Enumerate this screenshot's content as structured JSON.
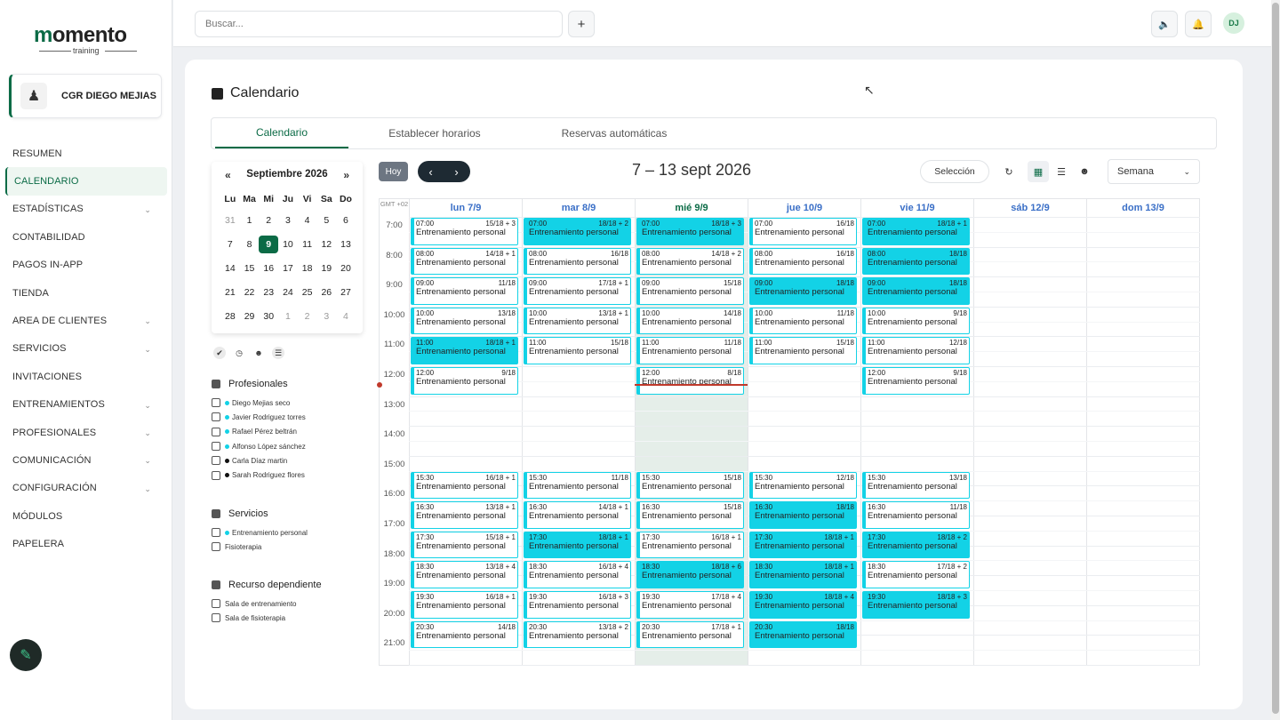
{
  "brand": {
    "name": "momento",
    "sub": "training"
  },
  "business": {
    "name": "CGR DIEGO MEJIAS"
  },
  "nav": [
    {
      "label": "RESUMEN",
      "caret": false
    },
    {
      "label": "CALENDARIO",
      "caret": false,
      "active": true
    },
    {
      "label": "ESTADÍSTICAS",
      "caret": true
    },
    {
      "label": "CONTABILIDAD",
      "caret": false
    },
    {
      "label": "PAGOS IN-APP",
      "caret": false
    },
    {
      "label": "TIENDA",
      "caret": false
    },
    {
      "label": "AREA DE CLIENTES",
      "caret": true
    },
    {
      "label": "SERVICIOS",
      "caret": true
    },
    {
      "label": "INVITACIONES",
      "caret": false
    },
    {
      "label": "ENTRENAMIENTOS",
      "caret": true
    },
    {
      "label": "PROFESIONALES",
      "caret": true
    },
    {
      "label": "COMUNICACIÓN",
      "caret": true
    },
    {
      "label": "CONFIGURACIÓN",
      "caret": true
    },
    {
      "label": "MÓDULOS",
      "caret": false
    },
    {
      "label": "PAPELERA",
      "caret": false
    }
  ],
  "topbar": {
    "search_placeholder": "Buscar...",
    "avatar": "DJ"
  },
  "page": {
    "title": "Calendario"
  },
  "tabs": [
    "Calendario",
    "Establecer horarios",
    "Reservas automáticas"
  ],
  "minical": {
    "title": "Septiembre 2026",
    "prev": "«",
    "next": "»",
    "weekdays": [
      "Lu",
      "Ma",
      "Mi",
      "Ju",
      "Vi",
      "Sa",
      "Do"
    ],
    "weeks": [
      [
        "31",
        "1",
        "2",
        "3",
        "4",
        "5",
        "6"
      ],
      [
        "7",
        "8",
        "9",
        "10",
        "11",
        "12",
        "13"
      ],
      [
        "14",
        "15",
        "16",
        "17",
        "18",
        "19",
        "20"
      ],
      [
        "21",
        "22",
        "23",
        "24",
        "25",
        "26",
        "27"
      ],
      [
        "28",
        "29",
        "30",
        "1",
        "2",
        "3",
        "4"
      ]
    ],
    "selected": "9"
  },
  "filters": {
    "professionals_title": "Profesionales",
    "professionals": [
      {
        "name": "Diego Mejias seco",
        "color": "#13d2e6"
      },
      {
        "name": "Javier Rodriguez torres",
        "color": "#13d2e6"
      },
      {
        "name": "Rafael Pérez beltrán",
        "color": "#13d2e6"
      },
      {
        "name": "Alfonso López sánchez",
        "color": "#13d2e6"
      },
      {
        "name": "Carla Díaz martin",
        "color": "#111111"
      },
      {
        "name": "Sarah Rodriguez flores",
        "color": "#111111"
      }
    ],
    "services_title": "Servicios",
    "services": [
      {
        "name": "Entrenamiento personal",
        "color": "#13d2e6"
      },
      {
        "name": "Fisioterapia",
        "color": ""
      }
    ],
    "resources_title": "Recurso dependiente",
    "resources": [
      {
        "name": "Sala de entrenamiento",
        "color": ""
      },
      {
        "name": "Sala de fisioterapia",
        "color": ""
      }
    ]
  },
  "toolbar": {
    "today": "Hoy",
    "range": "7 – 13 sept 2026",
    "selection": "Selección",
    "view": "Semana"
  },
  "calendar": {
    "gmt": "GMT +02",
    "days": [
      "lun 7/9",
      "mar 8/9",
      "mié 9/9",
      "jue 10/9",
      "vie 11/9",
      "sáb 12/9",
      "dom 13/9"
    ],
    "today_index": 2,
    "hours": [
      "7:00",
      "8:00",
      "9:00",
      "10:00",
      "11:00",
      "12:00",
      "13:00",
      "14:00",
      "15:00",
      "16:00",
      "17:00",
      "18:00",
      "19:00",
      "20:00",
      "21:00"
    ],
    "event_title": "Entrenamiento personal",
    "events": [
      {
        "day": 0,
        "time": "07:00",
        "count": "15/18 + 3",
        "full": false
      },
      {
        "day": 0,
        "time": "08:00",
        "count": "14/18 + 1",
        "full": false
      },
      {
        "day": 0,
        "time": "09:00",
        "count": "11/18",
        "full": false
      },
      {
        "day": 0,
        "time": "10:00",
        "count": "13/18",
        "full": false
      },
      {
        "day": 0,
        "time": "11:00",
        "count": "18/18 + 1",
        "full": true
      },
      {
        "day": 0,
        "time": "12:00",
        "count": "9/18",
        "full": false
      },
      {
        "day": 0,
        "time": "15:30",
        "count": "16/18 + 1",
        "full": false
      },
      {
        "day": 0,
        "time": "16:30",
        "count": "13/18 + 1",
        "full": false
      },
      {
        "day": 0,
        "time": "17:30",
        "count": "15/18 + 1",
        "full": false
      },
      {
        "day": 0,
        "time": "18:30",
        "count": "13/18 + 4",
        "full": false
      },
      {
        "day": 0,
        "time": "19:30",
        "count": "16/18 + 1",
        "full": false
      },
      {
        "day": 0,
        "time": "20:30",
        "count": "14/18",
        "full": false
      },
      {
        "day": 1,
        "time": "07:00",
        "count": "18/18 + 2",
        "full": true
      },
      {
        "day": 1,
        "time": "08:00",
        "count": "16/18",
        "full": false
      },
      {
        "day": 1,
        "time": "09:00",
        "count": "17/18 + 1",
        "full": false
      },
      {
        "day": 1,
        "time": "10:00",
        "count": "13/18 + 1",
        "full": false
      },
      {
        "day": 1,
        "time": "11:00",
        "count": "15/18",
        "full": false
      },
      {
        "day": 1,
        "time": "15:30",
        "count": "11/18",
        "full": false
      },
      {
        "day": 1,
        "time": "16:30",
        "count": "14/18 + 1",
        "full": false
      },
      {
        "day": 1,
        "time": "17:30",
        "count": "18/18 + 1",
        "full": true
      },
      {
        "day": 1,
        "time": "18:30",
        "count": "16/18 + 4",
        "full": false
      },
      {
        "day": 1,
        "time": "19:30",
        "count": "16/18 + 3",
        "full": false
      },
      {
        "day": 1,
        "time": "20:30",
        "count": "13/18 + 2",
        "full": false
      },
      {
        "day": 2,
        "time": "07:00",
        "count": "18/18 + 3",
        "full": true
      },
      {
        "day": 2,
        "time": "08:00",
        "count": "14/18 + 2",
        "full": false
      },
      {
        "day": 2,
        "time": "09:00",
        "count": "15/18",
        "full": false
      },
      {
        "day": 2,
        "time": "10:00",
        "count": "14/18",
        "full": false
      },
      {
        "day": 2,
        "time": "11:00",
        "count": "11/18",
        "full": false
      },
      {
        "day": 2,
        "time": "12:00",
        "count": "8/18",
        "full": false
      },
      {
        "day": 2,
        "time": "15:30",
        "count": "15/18",
        "full": false
      },
      {
        "day": 2,
        "time": "16:30",
        "count": "15/18",
        "full": false
      },
      {
        "day": 2,
        "time": "17:30",
        "count": "16/18 + 1",
        "full": false
      },
      {
        "day": 2,
        "time": "18:30",
        "count": "18/18 + 6",
        "full": true
      },
      {
        "day": 2,
        "time": "19:30",
        "count": "17/18 + 4",
        "full": false
      },
      {
        "day": 2,
        "time": "20:30",
        "count": "17/18 + 1",
        "full": false
      },
      {
        "day": 3,
        "time": "07:00",
        "count": "16/18",
        "full": false
      },
      {
        "day": 3,
        "time": "08:00",
        "count": "16/18",
        "full": false
      },
      {
        "day": 3,
        "time": "09:00",
        "count": "18/18",
        "full": true
      },
      {
        "day": 3,
        "time": "10:00",
        "count": "11/18",
        "full": false
      },
      {
        "day": 3,
        "time": "11:00",
        "count": "15/18",
        "full": false
      },
      {
        "day": 3,
        "time": "15:30",
        "count": "12/18",
        "full": false
      },
      {
        "day": 3,
        "time": "16:30",
        "count": "18/18",
        "full": true
      },
      {
        "day": 3,
        "time": "17:30",
        "count": "18/18 + 1",
        "full": true
      },
      {
        "day": 3,
        "time": "18:30",
        "count": "18/18 + 1",
        "full": true
      },
      {
        "day": 3,
        "time": "19:30",
        "count": "18/18 + 4",
        "full": true
      },
      {
        "day": 3,
        "time": "20:30",
        "count": "18/18",
        "full": true
      },
      {
        "day": 4,
        "time": "07:00",
        "count": "18/18 + 1",
        "full": true
      },
      {
        "day": 4,
        "time": "08:00",
        "count": "18/18",
        "full": true
      },
      {
        "day": 4,
        "time": "09:00",
        "count": "18/18",
        "full": true
      },
      {
        "day": 4,
        "time": "10:00",
        "count": "9/18",
        "full": false
      },
      {
        "day": 4,
        "time": "11:00",
        "count": "12/18",
        "full": false
      },
      {
        "day": 4,
        "time": "12:00",
        "count": "9/18",
        "full": false
      },
      {
        "day": 4,
        "time": "15:30",
        "count": "13/18",
        "full": false
      },
      {
        "day": 4,
        "time": "16:30",
        "count": "11/18",
        "full": false
      },
      {
        "day": 4,
        "time": "17:30",
        "count": "18/18 + 2",
        "full": true
      },
      {
        "day": 4,
        "time": "18:30",
        "count": "17/18 + 2",
        "full": false
      },
      {
        "day": 4,
        "time": "19:30",
        "count": "18/18 + 3",
        "full": true
      }
    ]
  },
  "colors": {
    "brand": "#0b6b46",
    "event": "#13d2e6",
    "link": "#3a6fc7",
    "now": "#c0392b"
  },
  "icons": {
    "add": "plus-icon",
    "sound": "speaker-icon",
    "bell": "bell-icon",
    "edit": "pencil-icon",
    "refresh": "refresh-icon",
    "views": [
      "grid-icon",
      "list-icon",
      "user-icon"
    ]
  }
}
